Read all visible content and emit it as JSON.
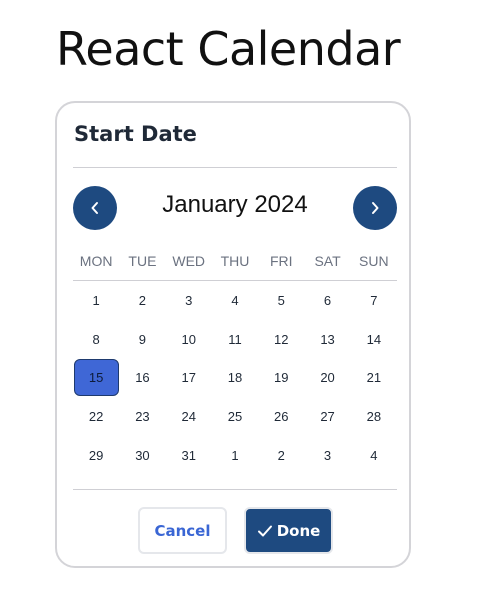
{
  "page": {
    "title": "React Calendar"
  },
  "card": {
    "title": "Start Date"
  },
  "calendar": {
    "month_label": "January 2024",
    "prev_icon": "chevron-left-icon",
    "next_icon": "chevron-right-icon",
    "weekdays": [
      "MON",
      "TUE",
      "WED",
      "THU",
      "FRI",
      "SAT",
      "SUN"
    ],
    "days": [
      {
        "label": "1",
        "outside": false
      },
      {
        "label": "2",
        "outside": false
      },
      {
        "label": "3",
        "outside": false
      },
      {
        "label": "4",
        "outside": false
      },
      {
        "label": "5",
        "outside": false
      },
      {
        "label": "6",
        "outside": false
      },
      {
        "label": "7",
        "outside": false
      },
      {
        "label": "8",
        "outside": false
      },
      {
        "label": "9",
        "outside": false
      },
      {
        "label": "10",
        "outside": false
      },
      {
        "label": "11",
        "outside": false
      },
      {
        "label": "12",
        "outside": false
      },
      {
        "label": "13",
        "outside": false
      },
      {
        "label": "14",
        "outside": false
      },
      {
        "label": "15",
        "outside": false
      },
      {
        "label": "16",
        "outside": false
      },
      {
        "label": "17",
        "outside": false
      },
      {
        "label": "18",
        "outside": false
      },
      {
        "label": "19",
        "outside": false
      },
      {
        "label": "20",
        "outside": false
      },
      {
        "label": "21",
        "outside": false
      },
      {
        "label": "22",
        "outside": false
      },
      {
        "label": "23",
        "outside": false
      },
      {
        "label": "24",
        "outside": false
      },
      {
        "label": "25",
        "outside": false
      },
      {
        "label": "26",
        "outside": false
      },
      {
        "label": "27",
        "outside": false
      },
      {
        "label": "28",
        "outside": false
      },
      {
        "label": "29",
        "outside": false
      },
      {
        "label": "30",
        "outside": false
      },
      {
        "label": "31",
        "outside": false
      },
      {
        "label": "1",
        "outside": true
      },
      {
        "label": "2",
        "outside": true
      },
      {
        "label": "3",
        "outside": true
      },
      {
        "label": "4",
        "outside": true
      }
    ],
    "selected_day": "15"
  },
  "actions": {
    "cancel_label": "Cancel",
    "done_label": "Done",
    "done_icon": "check-icon"
  },
  "colors": {
    "primary": "#1e4a80",
    "selected": "#3f67d6",
    "cancel_text": "#3a66d4",
    "border": "#d4d4d8",
    "muted_text": "#6b7280"
  }
}
